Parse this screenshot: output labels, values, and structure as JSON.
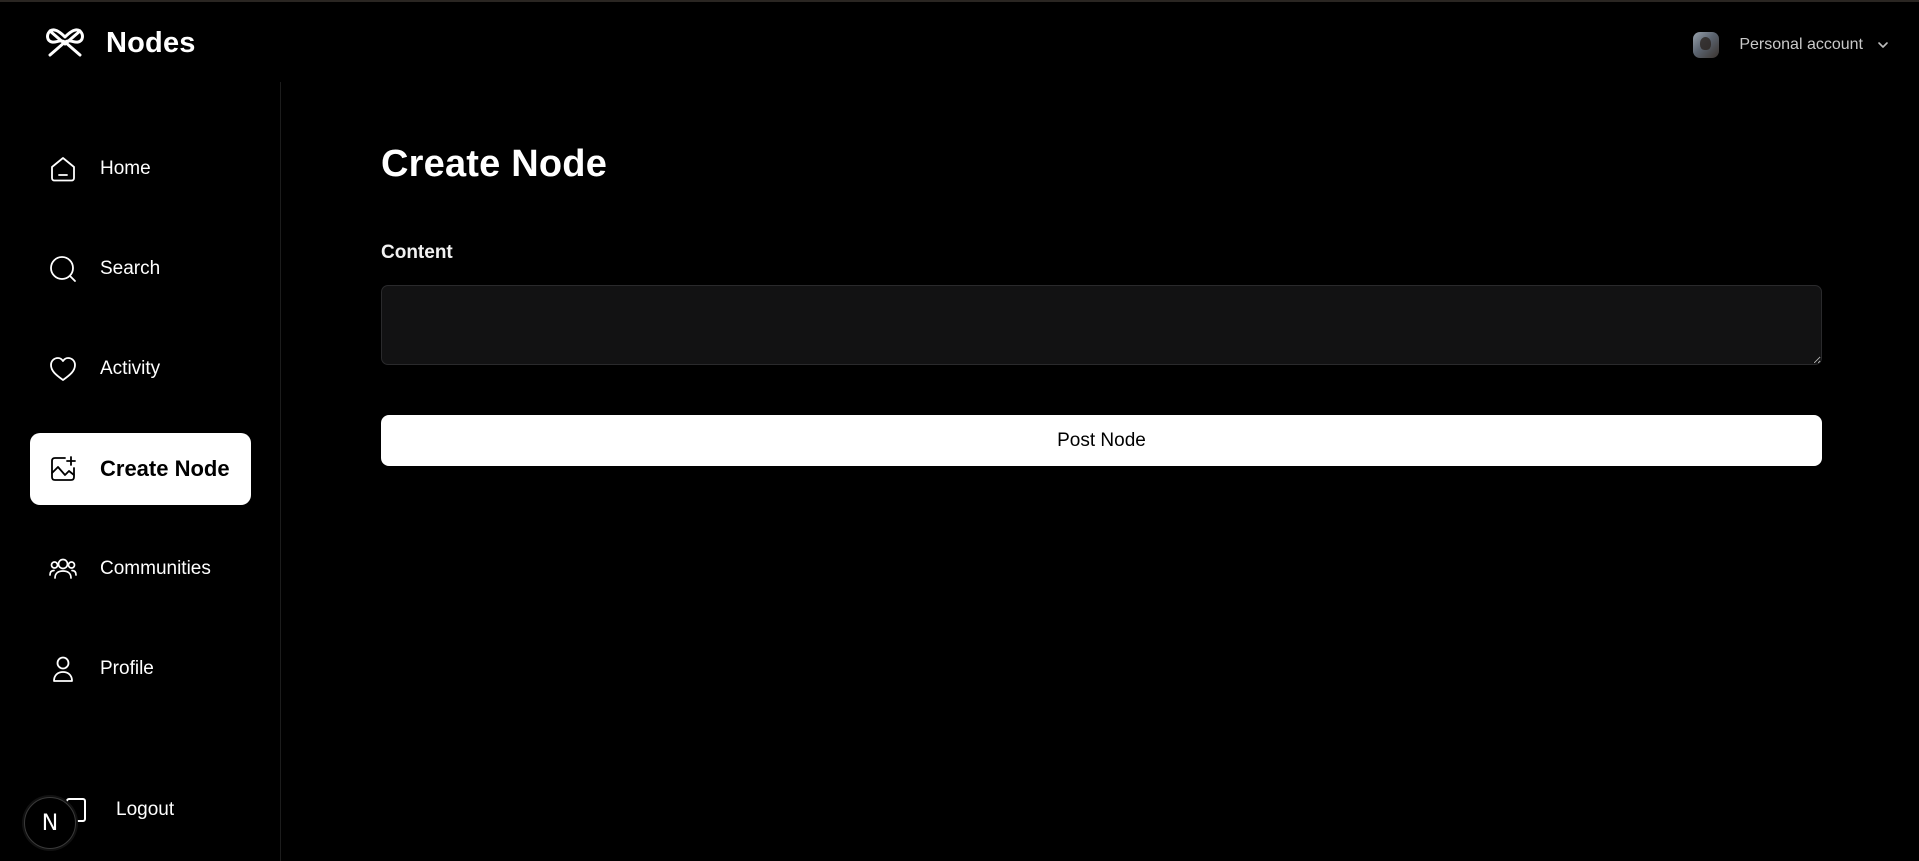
{
  "app": {
    "name": "Nodes",
    "logo_icon": "nodes-logo-icon"
  },
  "account": {
    "label": "Personal account",
    "avatar_icon": "avatar",
    "dropdown_icon": "chevron-down-icon"
  },
  "sidebar": {
    "items": [
      {
        "label": "Home",
        "icon": "home-icon",
        "active": false
      },
      {
        "label": "Search",
        "icon": "search-icon",
        "active": false
      },
      {
        "label": "Activity",
        "icon": "heart-icon",
        "active": false
      },
      {
        "label": "Create Node",
        "icon": "image-plus-icon",
        "active": true
      },
      {
        "label": "Communities",
        "icon": "users-icon",
        "active": false
      },
      {
        "label": "Profile",
        "icon": "user-icon",
        "active": false
      }
    ],
    "logout_label": "Logout",
    "dev_badge": "N"
  },
  "main": {
    "title": "Create Node",
    "content_label": "Content",
    "content_value": "",
    "post_button_label": "Post Node"
  },
  "colors": {
    "background": "#000000",
    "active_item_bg": "#ffffff",
    "textarea_bg": "#121213",
    "button_bg": "#ffffff"
  }
}
